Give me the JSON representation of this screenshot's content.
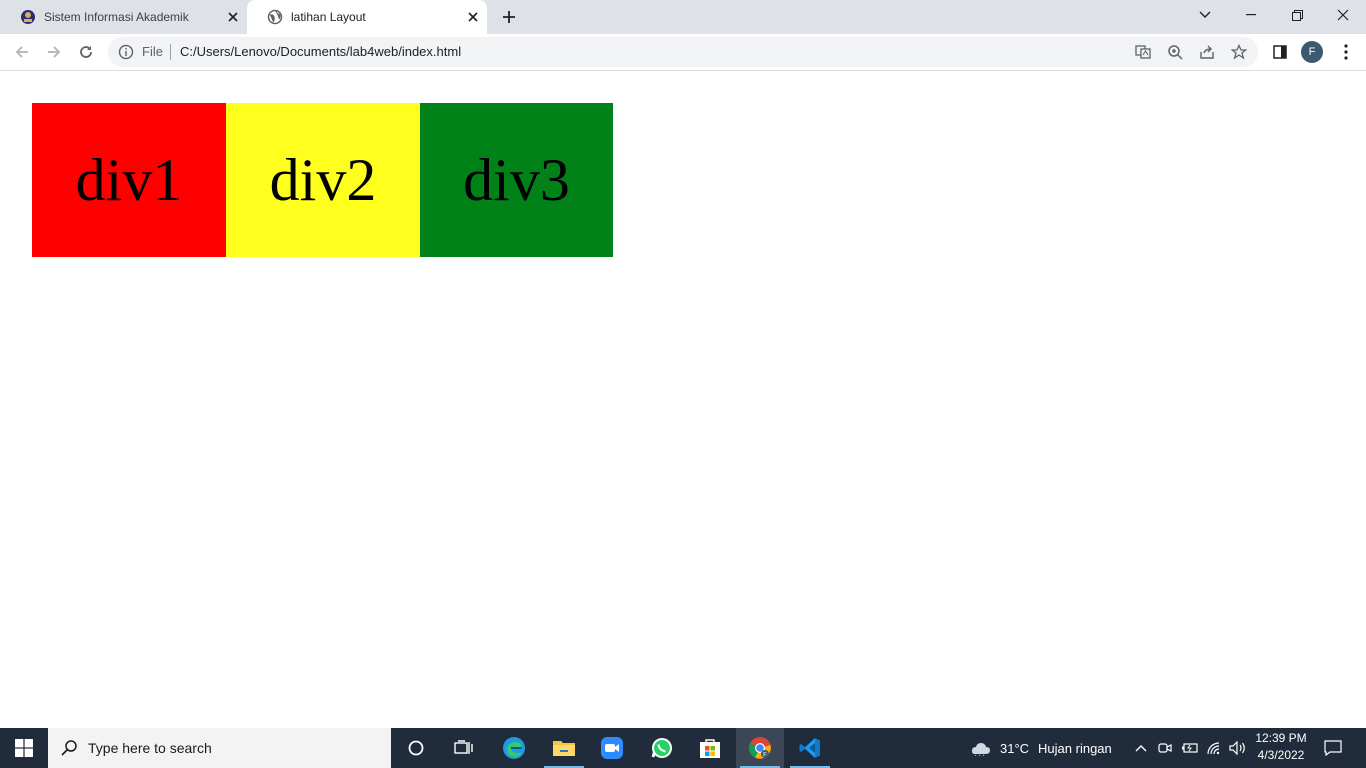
{
  "browser": {
    "tabs": [
      {
        "title": "Sistem Informasi Akademik",
        "active": false,
        "icon": "university-logo-icon"
      },
      {
        "title": "latihan Layout",
        "active": true,
        "icon": "globe-icon"
      }
    ],
    "address": {
      "scheme_label": "File",
      "url": "C:/Users/Lenovo/Documents/lab4web/index.html"
    },
    "profile_initial": "F"
  },
  "page": {
    "boxes": [
      {
        "label": "div1",
        "color": "#ff0000"
      },
      {
        "label": "div2",
        "color": "#ffff1e"
      },
      {
        "label": "div3",
        "color": "#008219"
      }
    ]
  },
  "taskbar": {
    "search_placeholder": "Type here to search",
    "weather": {
      "temperature": "31°C",
      "condition": "Hujan ringan"
    },
    "clock": {
      "time": "12:39 PM",
      "date": "4/3/2022"
    },
    "apps": [
      "cortana-icon",
      "task-view-icon",
      "edge-icon",
      "file-explorer-icon",
      "zoom-icon",
      "whatsapp-icon",
      "store-icon",
      "chrome-icon",
      "vscode-icon"
    ],
    "accent": "#76b9ed"
  }
}
